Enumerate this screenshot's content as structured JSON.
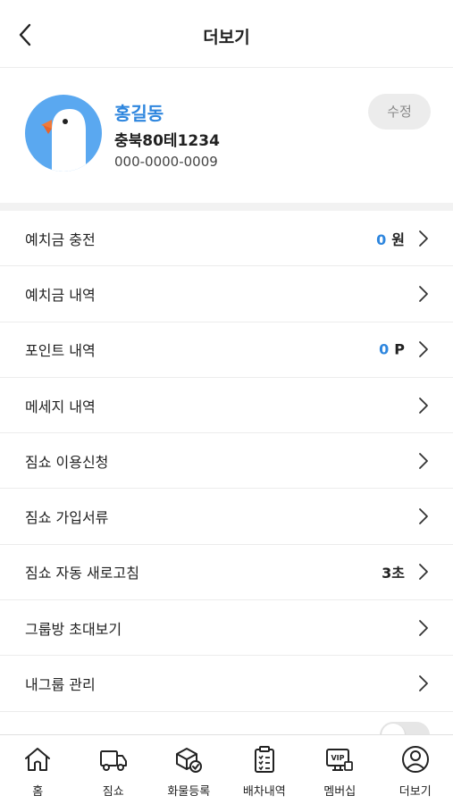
{
  "header": {
    "title": "더보기",
    "back_icon": "chevron-left-icon"
  },
  "profile": {
    "avatar_icon": "penguin-avatar-icon",
    "name": "홍길동",
    "plate": "충북80테1234",
    "phone": "000-0000-0009",
    "edit_label": "수정"
  },
  "menu": {
    "items": [
      {
        "label": "예치금 충전",
        "value_num": "0",
        "value_unit": "원"
      },
      {
        "label": "예치금 내역"
      },
      {
        "label": "포인트 내역",
        "value_num": "0",
        "value_unit": "P"
      },
      {
        "label": "메세지 내역"
      },
      {
        "label": "짐쇼 이용신청"
      },
      {
        "label": "짐쇼 가입서류"
      },
      {
        "label": "짐쇼 자동 새로고침",
        "value_text": "3초"
      },
      {
        "label": "그룹방 초대보기"
      },
      {
        "label": "내그룹 관리"
      }
    ]
  },
  "tabbar": {
    "tabs": [
      {
        "label": "홈",
        "icon": "home-icon"
      },
      {
        "label": "짐쇼",
        "icon": "truck-icon"
      },
      {
        "label": "화물등록",
        "icon": "box-check-icon"
      },
      {
        "label": "배차내역",
        "icon": "clipboard-list-icon"
      },
      {
        "label": "멤버십",
        "icon": "vip-card-icon"
      },
      {
        "label": "더보기",
        "icon": "user-circle-icon"
      }
    ]
  },
  "colors": {
    "accent": "#2e86de",
    "avatar_bg": "#5aa8f0",
    "divider": "#ececec"
  }
}
